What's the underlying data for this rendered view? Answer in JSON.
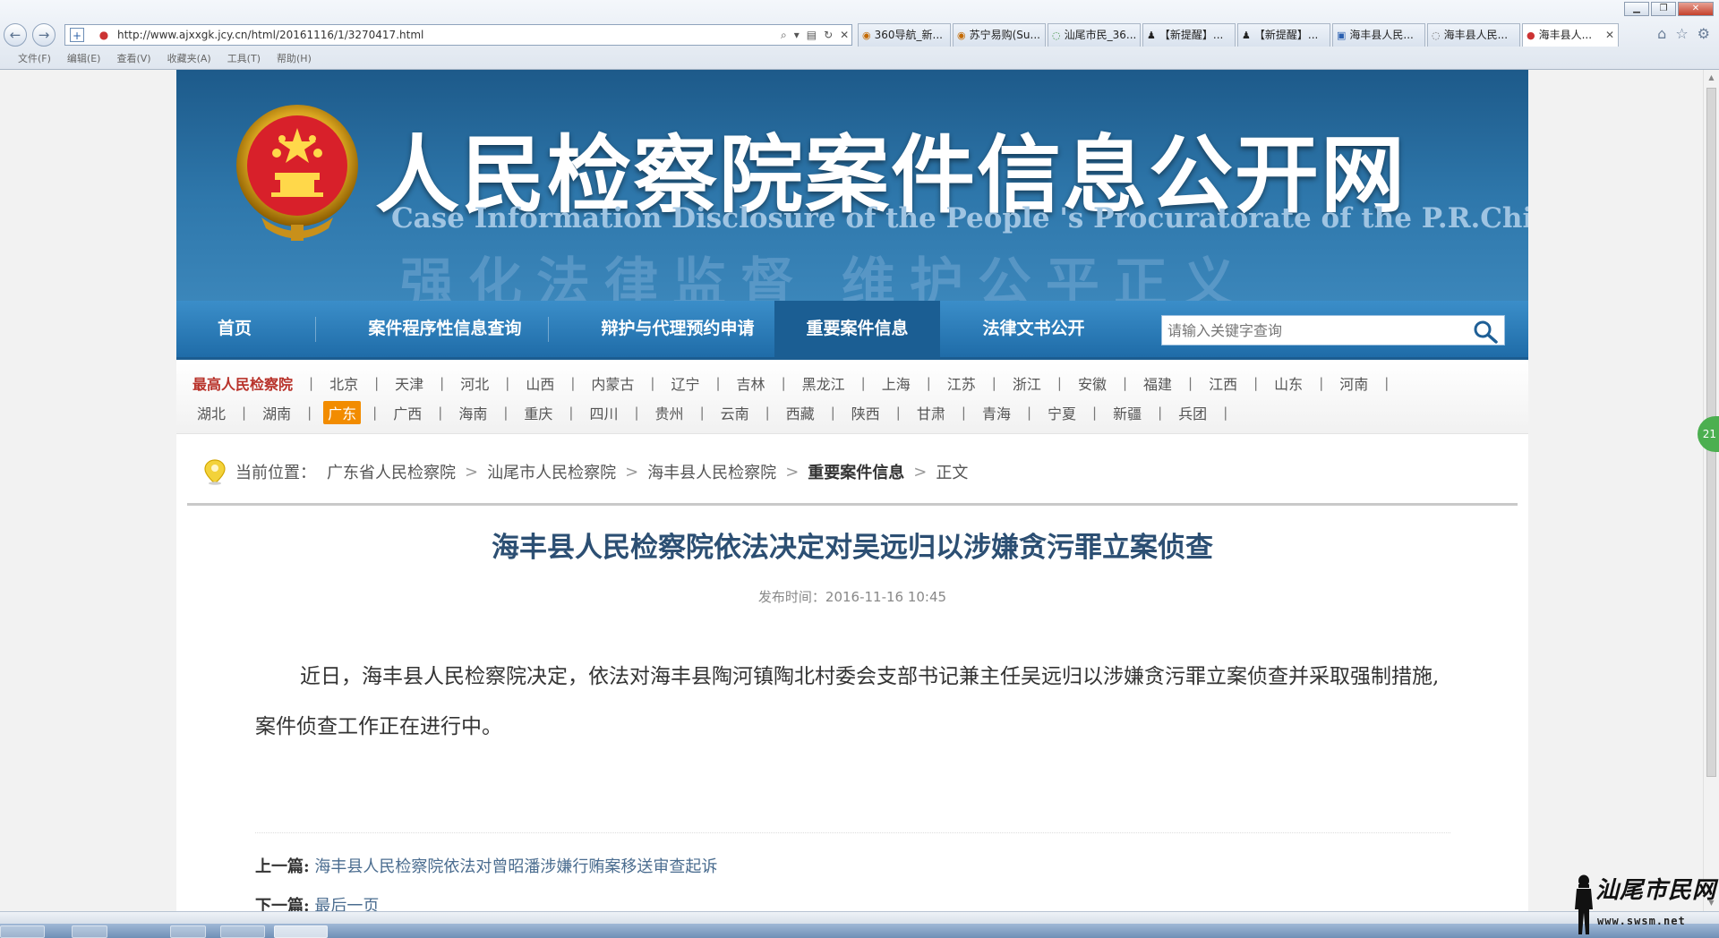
{
  "browser": {
    "url": "http://www.ajxxgk.jcy.cn/html/20161116/1/3270417.html",
    "tabs": [
      {
        "label": "360导航_新..."
      },
      {
        "label": "苏宁易购(Su..."
      },
      {
        "label": "汕尾市民_36..."
      },
      {
        "label": "【新提醒】..."
      },
      {
        "label": "【新提醒】..."
      },
      {
        "label": "海丰县人民..."
      },
      {
        "label": "海丰县人民..."
      },
      {
        "label": "海丰县人..."
      }
    ],
    "menu": [
      "文件(F)",
      "编辑(E)",
      "查看(V)",
      "收藏夹(A)",
      "工具(T)",
      "帮助(H)"
    ],
    "side_badge": "21"
  },
  "site": {
    "title": "人民检察院案件信息公开网",
    "subtitle": "Case Information Disclosure of the People 's Procuratorate of the P.R.China",
    "slogan": "强化法律监督 维护公平正义",
    "nav": [
      "首页",
      "案件程序性信息查询",
      "辩护与代理预约申请",
      "重要案件信息",
      "法律文书公开"
    ],
    "nav_active_index": 3,
    "search_placeholder": "请输入关键字查询",
    "provinces_row1": [
      "最高人民检察院",
      "北京",
      "天津",
      "河北",
      "山西",
      "内蒙古",
      "辽宁",
      "吉林",
      "黑龙江",
      "上海",
      "江苏",
      "浙江",
      "安徽",
      "福建",
      "江西",
      "山东",
      "河南"
    ],
    "provinces_row2": [
      "湖北",
      "湖南",
      "广东",
      "广西",
      "海南",
      "重庆",
      "四川",
      "贵州",
      "云南",
      "西藏",
      "陕西",
      "甘肃",
      "青海",
      "宁夏",
      "新疆",
      "兵团"
    ],
    "active_province": "广东"
  },
  "breadcrumb": {
    "label": "当前位置：",
    "items": [
      "广东省人民检察院",
      "汕尾市人民检察院",
      "海丰县人民检察院",
      "重要案件信息",
      "正文"
    ],
    "sep": ">"
  },
  "article": {
    "title": "海丰县人民检察院依法决定对吴远归以涉嫌贪污罪立案侦查",
    "publish_time": "发布时间：2016-11-16 10:45",
    "body": "近日，海丰县人民检察院决定，依法对海丰县陶河镇陶北村委会支部书记兼主任吴远归以涉嫌贪污罪立案侦查并采取强制措施,案件侦查工作正在进行中。",
    "prev_label": "上一篇:",
    "prev_title": "海丰县人民检察院依法对曾昭潘涉嫌行贿案移送审查起诉",
    "next_label": "下一篇:",
    "next_title": "最后一页"
  },
  "watermark": {
    "text": "汕尾市民网",
    "url": "www.swsm.net"
  },
  "colors": {
    "banner": "#2e77ab",
    "nav": "#2a7dbb",
    "nav_active": "#1b5e93",
    "active_province": "#f28c00",
    "supreme": "#b8322a",
    "title": "#2c4f73"
  }
}
